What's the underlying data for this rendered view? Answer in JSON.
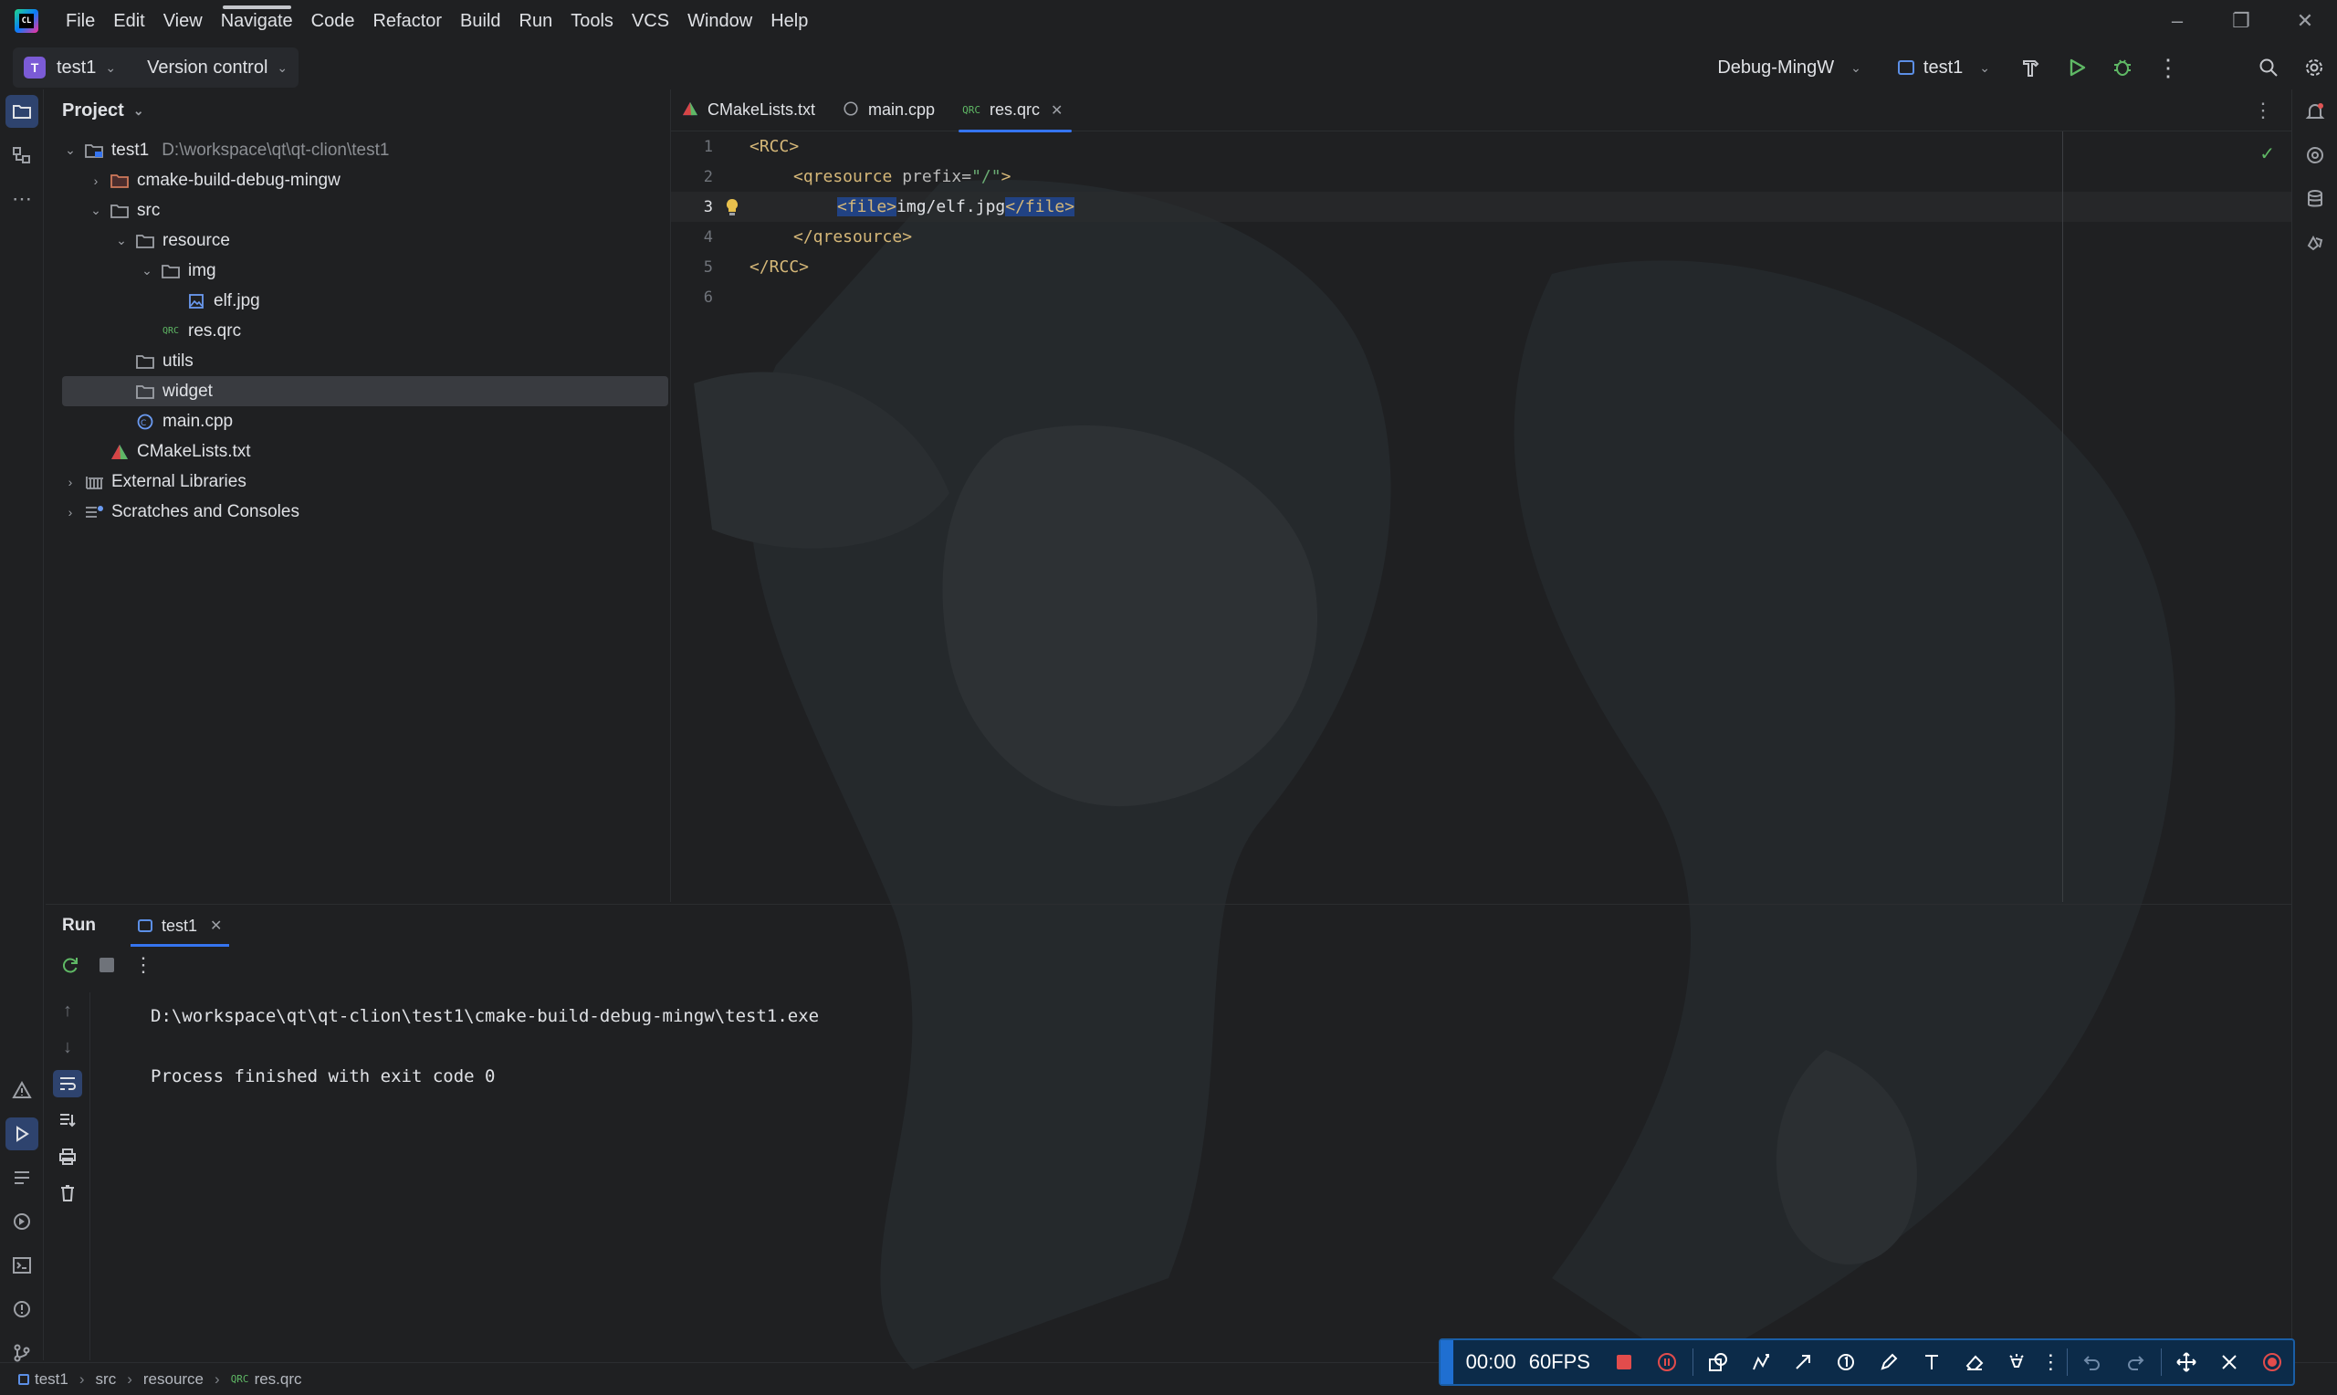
{
  "app": {
    "title_menu": [
      "File",
      "Edit",
      "View",
      "Navigate",
      "Code",
      "Refactor",
      "Build",
      "Run",
      "Tools",
      "VCS",
      "Window",
      "Help"
    ],
    "logo": "clion-logo"
  },
  "toolbar": {
    "project_badge": "T",
    "project_name": "test1",
    "version_control": "Version control",
    "build_config": "Debug-MingW",
    "run_target": "test1"
  },
  "project_panel": {
    "title": "Project",
    "tree": [
      {
        "label": "test1",
        "path": "D:\\workspace\\qt\\qt-clion\\test1",
        "depth": 0,
        "toggle": "open",
        "icon": "module-folder-icon"
      },
      {
        "label": "cmake-build-debug-mingw",
        "depth": 1,
        "toggle": "closed",
        "icon": "excluded-folder-icon"
      },
      {
        "label": "src",
        "depth": 1,
        "toggle": "open",
        "icon": "folder-icon"
      },
      {
        "label": "resource",
        "depth": 2,
        "toggle": "open",
        "icon": "folder-icon"
      },
      {
        "label": "img",
        "depth": 3,
        "toggle": "open",
        "icon": "folder-icon"
      },
      {
        "label": "elf.jpg",
        "depth": 4,
        "toggle": "none",
        "icon": "image-file-icon"
      },
      {
        "label": "res.qrc",
        "depth": 3,
        "toggle": "none",
        "icon": "qrc-file-icon"
      },
      {
        "label": "utils",
        "depth": 2,
        "toggle": "none",
        "icon": "folder-icon"
      },
      {
        "label": "widget",
        "depth": 2,
        "toggle": "none",
        "icon": "folder-icon",
        "selected": true
      },
      {
        "label": "main.cpp",
        "depth": 2,
        "toggle": "none",
        "icon": "cpp-file-icon"
      },
      {
        "label": "CMakeLists.txt",
        "depth": 1,
        "toggle": "none",
        "icon": "cmake-file-icon"
      },
      {
        "label": "External Libraries",
        "depth": 0,
        "toggle": "closed",
        "icon": "library-icon"
      },
      {
        "label": "Scratches and Consoles",
        "depth": 0,
        "toggle": "closed",
        "icon": "scratches-icon"
      }
    ]
  },
  "editor": {
    "tabs": [
      {
        "label": "CMakeLists.txt",
        "icon": "cmake-file-icon",
        "active": false
      },
      {
        "label": "main.cpp",
        "icon": "cpp-file-icon",
        "active": false
      },
      {
        "label": "res.qrc",
        "icon": "qrc-file-icon",
        "active": true,
        "badge": "QRC"
      }
    ],
    "current_line": 3,
    "lines": [
      {
        "n": "1",
        "code": "<RCC>"
      },
      {
        "n": "2",
        "code": "    <qresource prefix=\"/\">"
      },
      {
        "n": "3",
        "code": "        <file>img/elf.jpg</file>"
      },
      {
        "n": "4",
        "code": "    </qresource>"
      },
      {
        "n": "5",
        "code": "</RCC>"
      },
      {
        "n": "6",
        "code": ""
      }
    ],
    "line_parts": {
      "l1": {
        "open": "<RCC>"
      },
      "l2": {
        "tag": "<qresource",
        "attr": " prefix=",
        "val": "\"/\"",
        "close": ">"
      },
      "l3": {
        "open": "<file>",
        "text": "img/elf.jpg",
        "close": "</file>"
      },
      "l4": {
        "close": "</qresource>"
      },
      "l5": {
        "close": "</RCC>"
      }
    }
  },
  "run_panel": {
    "title": "Run",
    "tab": "test1",
    "output": [
      "D:\\workspace\\qt\\qt-clion\\test1\\cmake-build-debug-mingw\\test1.exe",
      "",
      "Process finished with exit code 0"
    ]
  },
  "status_bar": {
    "breadcrumbs": [
      "test1",
      "src",
      "resource",
      "res.qrc"
    ],
    "qrc_badge": "QRC"
  },
  "recorder": {
    "time": "00:00",
    "fps": "60FPS"
  },
  "colors": {
    "accent": "#3574f0",
    "tag": "#d5b778",
    "string": "#6aab73",
    "recorder_bg": "#0c2b49"
  }
}
